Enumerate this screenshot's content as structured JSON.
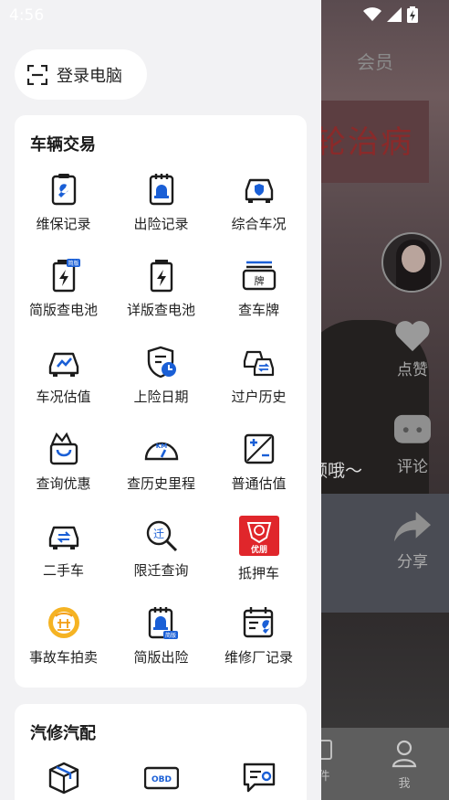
{
  "status_bar": {
    "time": "4:56"
  },
  "background": {
    "top_title": "会员",
    "poster_text": "轮治病",
    "caption": "频哦～",
    "actions": [
      {
        "label": "点赞",
        "icon": "heart-icon"
      },
      {
        "label": "评论",
        "icon": "comment-icon"
      },
      {
        "label": "分享",
        "icon": "share-icon"
      }
    ],
    "bottom_tabs": [
      {
        "label": "件",
        "icon": "file-icon"
      },
      {
        "label": "我",
        "icon": "person-icon"
      }
    ]
  },
  "drawer": {
    "login_button": {
      "label": "登录电脑",
      "icon": "scan-icon"
    },
    "sections": [
      {
        "title": "车辆交易",
        "items": [
          {
            "label": "维保记录",
            "icon": "wrench-clipboard-icon"
          },
          {
            "label": "出险记录",
            "icon": "alarm-clipboard-icon"
          },
          {
            "label": "综合车况",
            "icon": "car-shield-icon"
          },
          {
            "label": "简版查电池",
            "icon": "battery-simple-icon",
            "badge": "简版"
          },
          {
            "label": "详版查电池",
            "icon": "battery-detail-icon"
          },
          {
            "label": "查车牌",
            "icon": "license-plate-icon",
            "plate_char": "牌"
          },
          {
            "label": "车况估值",
            "icon": "car-chart-icon"
          },
          {
            "label": "上险日期",
            "icon": "shield-clock-icon"
          },
          {
            "label": "过户历史",
            "icon": "car-transfer-icon"
          },
          {
            "label": "查询优惠",
            "icon": "shopping-bag-icon"
          },
          {
            "label": "查历史里程",
            "icon": "odometer-icon",
            "gauge_text": "KM"
          },
          {
            "label": "普通估值",
            "icon": "calculator-icon"
          },
          {
            "label": "二手车",
            "icon": "car-exchange-icon"
          },
          {
            "label": "限迁查询",
            "icon": "search-move-icon",
            "glyph": "迁"
          },
          {
            "label": "抵押车",
            "icon": "youpeng-logo-icon",
            "logo_text": "优朋"
          },
          {
            "label": "事故车拍卖",
            "icon": "auction-logo-icon"
          },
          {
            "label": "简版出险",
            "icon": "alarm-clipboard-simple-icon",
            "badge": "简版"
          },
          {
            "label": "维修厂记录",
            "icon": "calendar-wrench-icon"
          }
        ]
      },
      {
        "title": "汽修汽配",
        "items": [
          {
            "label": "",
            "icon": "box-icon"
          },
          {
            "label": "",
            "icon": "obd-icon",
            "device_text": "OBD"
          },
          {
            "label": "",
            "icon": "message-gear-icon"
          }
        ]
      }
    ]
  },
  "colors": {
    "accent": "#1a5fd6",
    "icon_dark": "#1c1c1c",
    "red": "#e0262b",
    "orange": "#f39c12"
  }
}
